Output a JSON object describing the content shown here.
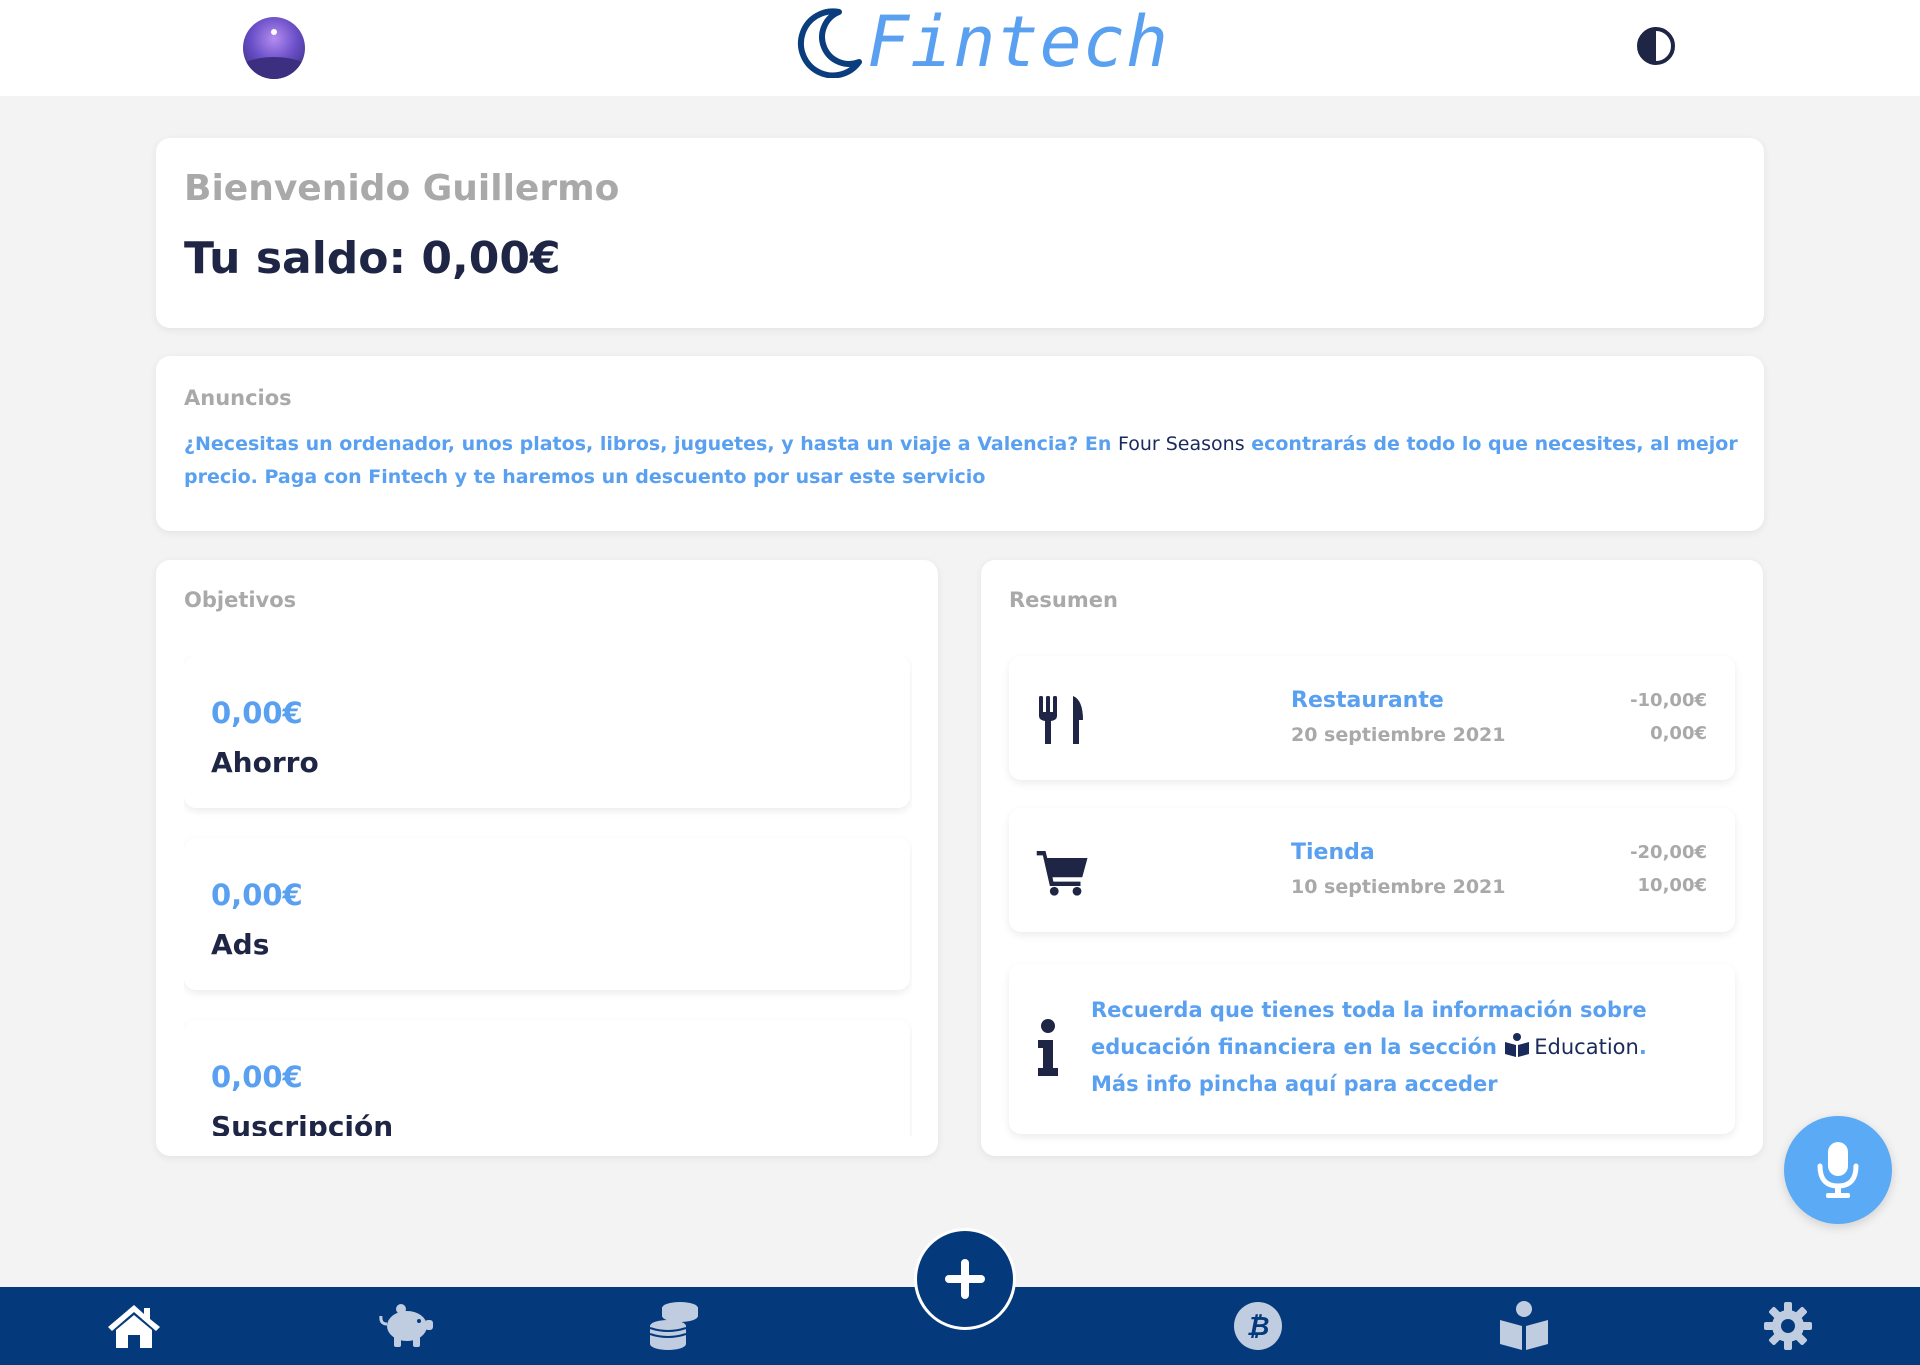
{
  "header": {
    "logo_text": "Fintech",
    "avatar_alt": "avatar",
    "theme_toggle": "contrast-icon"
  },
  "welcome": {
    "greeting": "Bienvenido Guillermo",
    "balance": "Tu saldo: 0,00€"
  },
  "ads": {
    "title": "Anuncios",
    "text_before": "¿Necesitas un ordenador, unos platos, libros, juguetes, y hasta un viaje a Valencia? En ",
    "brand": "Four Seasons",
    "text_after": " econtrarás de todo lo que necesites, al mejor precio. Paga con Fintech y te haremos un descuento por usar este servicio"
  },
  "goals": {
    "title": "Objetivos",
    "items": [
      {
        "amount": "0,00€",
        "name": "Ahorro"
      },
      {
        "amount": "0,00€",
        "name": "Ads"
      },
      {
        "amount": "0,00€",
        "name": "Suscripción"
      }
    ]
  },
  "summary": {
    "title": "Resumen",
    "transactions": [
      {
        "icon": "utensils-icon",
        "name": "Restaurante",
        "date": "20 septiembre 2021",
        "amount": "-10,00€",
        "balance": "0,00€"
      },
      {
        "icon": "shopping-cart-icon",
        "name": "Tienda",
        "date": "10 septiembre 2021",
        "amount": "-20,00€",
        "balance": "10,00€"
      }
    ],
    "info": {
      "icon": "info-icon",
      "text_before": "Recuerda que tienes toda la información sobre educación financiera en la sección ",
      "section_label": "Education",
      "text_after": ". Más info pincha aquí para acceder"
    }
  },
  "fab": {
    "mic_icon": "microphone-icon",
    "add_icon": "plus-icon"
  },
  "bottom_nav": {
    "items": [
      "home-icon",
      "piggy-bank-icon",
      "coins-icon",
      "bitcoin-icon",
      "book-reader-icon",
      "gear-icon"
    ]
  },
  "colors": {
    "accent": "#5aa0f0",
    "nav_background": "#043a7c",
    "text_dark": "#1f2544",
    "text_muted": "#a9a9a9",
    "page_background": "#f3f3f3"
  }
}
